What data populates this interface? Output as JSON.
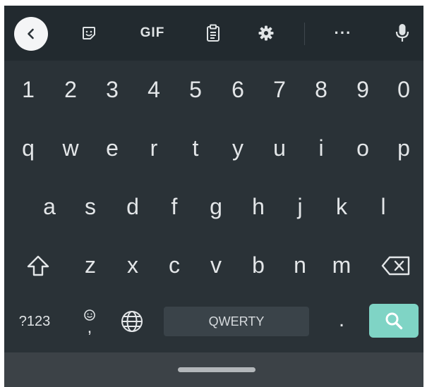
{
  "keyboard": {
    "layout_name": "QWERTY",
    "colors": {
      "toolbar_bg": "#222a2f",
      "keys_bg": "#2a3237",
      "key_text": "#e3e6e8",
      "enter_accent": "#7fd4c5",
      "space_bg": "#3a4349",
      "nav_bg": "#3c4247"
    },
    "toolbar": {
      "items": [
        {
          "name": "back",
          "icon": "chevron-left-icon"
        },
        {
          "name": "sticker",
          "icon": "sticker-icon"
        },
        {
          "name": "gif",
          "label": "GIF"
        },
        {
          "name": "clipboard",
          "icon": "clipboard-icon"
        },
        {
          "name": "settings",
          "icon": "gear-icon"
        },
        {
          "name": "more",
          "label": "···"
        },
        {
          "name": "voice",
          "icon": "microphone-icon"
        }
      ]
    },
    "rows": {
      "numbers": [
        "1",
        "2",
        "3",
        "4",
        "5",
        "6",
        "7",
        "8",
        "9",
        "0"
      ],
      "top": [
        "q",
        "w",
        "e",
        "r",
        "t",
        "y",
        "u",
        "i",
        "o",
        "p"
      ],
      "middle": [
        "a",
        "s",
        "d",
        "f",
        "g",
        "h",
        "j",
        "k",
        "l"
      ],
      "bottom": [
        "z",
        "x",
        "c",
        "v",
        "b",
        "n",
        "m"
      ]
    },
    "bottom_bar": {
      "symbols_label": "?123",
      "comma_label": ",",
      "emoji_icon": "emoji-icon",
      "language_icon": "globe-icon",
      "space_label": "QWERTY",
      "period_label": ".",
      "enter_icon": "search-icon"
    },
    "shift_icon": "shift-icon",
    "backspace_icon": "backspace-icon"
  }
}
